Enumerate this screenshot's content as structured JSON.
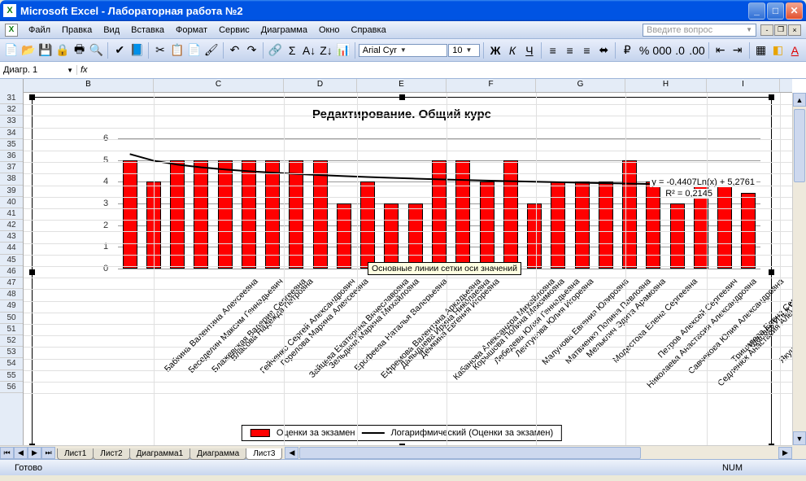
{
  "window": {
    "title": "Microsoft Excel - Лабораторная работа №2"
  },
  "menu": {
    "items": [
      "Файл",
      "Правка",
      "Вид",
      "Вставка",
      "Формат",
      "Сервис",
      "Диаграмма",
      "Окно",
      "Справка"
    ],
    "helpbox_placeholder": "Введите вопрос"
  },
  "toolbar": {
    "font_name": "Arial Cyr",
    "font_size": "10"
  },
  "formula_bar": {
    "name_box": "Диагр. 1",
    "fx": "fx"
  },
  "columns": [
    {
      "label": "B",
      "w": 160
    },
    {
      "label": "C",
      "w": 160
    },
    {
      "label": "D",
      "w": 90
    },
    {
      "label": "E",
      "w": 110
    },
    {
      "label": "F",
      "w": 110
    },
    {
      "label": "G",
      "w": 110
    },
    {
      "label": "H",
      "w": 100
    },
    {
      "label": "I",
      "w": 90
    }
  ],
  "rows_start": 31,
  "rows_end": 56,
  "sheets": {
    "tabs": [
      "Лист1",
      "Лист2",
      "Диаграмма1",
      "Диаграмма",
      "Лист3"
    ],
    "active": "Лист3"
  },
  "statusbar": {
    "ready": "Готово",
    "num": "NUM"
  },
  "chart_data": {
    "type": "bar",
    "title": "Редактирование. Общий курс",
    "ylabel": "",
    "xlabel": "",
    "ylim": [
      0,
      6
    ],
    "yticks": [
      0,
      1,
      2,
      3,
      4,
      5,
      6
    ],
    "categories": [
      "Бабкина Валентина Алексеевна",
      "Беседелин Максим  Геннадьевич",
      "Блажевская Валерия Сергеевна",
      "Власова Надежда Петровна",
      "Гейченко Сергей Александрович",
      "Горелова Марина Алексеевна",
      "Зайцева Екатерина Вячеславовна",
      "Зельдина  Марина Михайловна",
      "Ерофеева  Наталья Валерьевна",
      "Ефремова Валентина Аркадьевна",
      "Давыдцева Ирина Николаевна",
      "Демкина Евгения Игоревна",
      "Кабанова Александра Михайловна",
      "Корышова Полина Максимовна",
      "Лебедева Юлия Геннадьевна",
      "Лентунова Юлия Игоревна",
      "Малунова Евгения Юлировна",
      "Матвиенко Полина Павловна",
      "Мельклич Эдита Арамовна",
      "Модестова Елена Сергеевна",
      "Николаева Анастасия Александровна",
      "Петров Алексей Сергеевич",
      "Савчекова Юлия Александровна",
      "Седленюк Анастасия Александровна",
      "Трицилева Елена Сергеевна",
      "Шалаев Илья Олегович",
      "Якушев Алексей Николаевич"
    ],
    "series": [
      {
        "name": "Оценки за экзамен",
        "values": [
          5,
          4,
          5,
          5,
          5,
          5,
          5,
          5,
          5,
          3,
          4,
          3,
          3,
          5,
          5,
          4,
          5,
          3,
          4,
          4,
          4,
          5,
          4,
          3,
          4,
          4,
          3.5
        ]
      }
    ],
    "trendline": {
      "name": "Логарифмический (Оценки за экзамен)",
      "equation": "y = -0,4407Ln(x) + 5,2761",
      "r2": "R² = 0,2145"
    },
    "tooltip": "Основные линии сетки оси значений",
    "legend": {
      "series_label": "Оценки за экзамен",
      "trend_label": "Логарифмический (Оценки за экзамен)"
    }
  }
}
